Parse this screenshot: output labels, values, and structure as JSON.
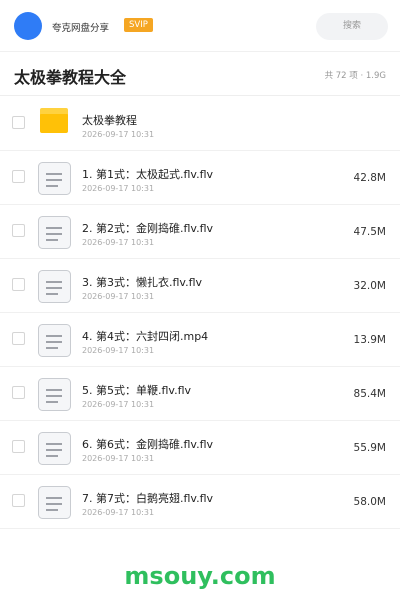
{
  "header": {
    "username": "夸克网盘分享",
    "badge": "SVIP",
    "search_placeholder": "搜索"
  },
  "folder": {
    "title": "太极拳教程大全",
    "meta": "共 72 项 · 1.9G"
  },
  "items": [
    {
      "type": "folder",
      "name": "太极拳教程",
      "date": "2026-09-17 10:31",
      "size": ""
    },
    {
      "type": "file",
      "name": "1. 第1式：太极起式.flv.flv",
      "date": "2026-09-17 10:31",
      "size": "42.8M"
    },
    {
      "type": "file",
      "name": "2. 第2式：金刚捣碓.flv.flv",
      "date": "2026-09-17 10:31",
      "size": "47.5M"
    },
    {
      "type": "file",
      "name": "3. 第3式：懒扎衣.flv.flv",
      "date": "2026-09-17 10:31",
      "size": "32.0M"
    },
    {
      "type": "file",
      "name": "4. 第4式：六封四闭.mp4",
      "date": "2026-09-17 10:31",
      "size": "13.9M"
    },
    {
      "type": "file",
      "name": "5. 第5式：单鞭.flv.flv",
      "date": "2026-09-17 10:31",
      "size": "85.4M"
    },
    {
      "type": "file",
      "name": "6. 第6式：金刚捣碓.flv.flv",
      "date": "2026-09-17 10:31",
      "size": "55.9M"
    },
    {
      "type": "file",
      "name": "7. 第7式：白鹅亮翅.flv.flv",
      "date": "2026-09-17 10:31",
      "size": "58.0M"
    }
  ],
  "watermark": "msouy.com",
  "colors": {
    "avatar": "#2f7cf6",
    "badge": "#f5a623",
    "folder": "#ffc107",
    "watermark": "#2fbf5e"
  }
}
